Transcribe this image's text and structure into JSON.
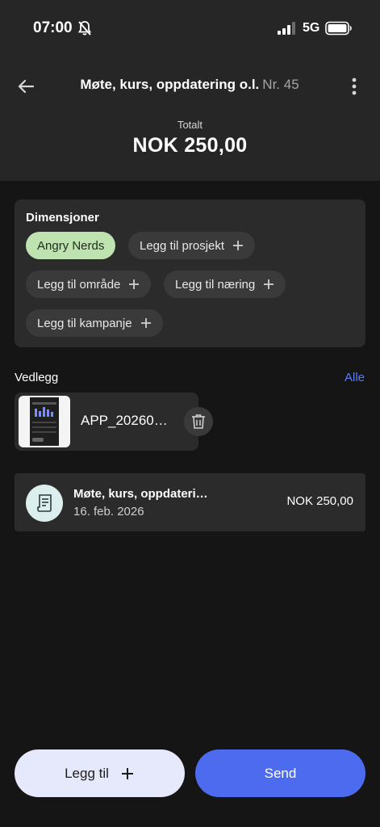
{
  "status_bar": {
    "time": "07:00",
    "network": "5G",
    "icons": [
      "bell-slash-icon",
      "signal-icon",
      "battery-icon"
    ]
  },
  "header": {
    "title": "Møte, kurs, oppdatering o.l.",
    "number": "Nr. 45",
    "total_label": "Totalt",
    "total_value": "NOK 250,00",
    "icons": [
      "arrow-left-icon",
      "more-vertical-icon"
    ]
  },
  "dimensions": {
    "title": "Dimensjoner",
    "chips": [
      {
        "label": "Angry Nerds",
        "active": true
      },
      {
        "label": "Legg til prosjekt",
        "active": false
      },
      {
        "label": "Legg til område",
        "active": false
      },
      {
        "label": "Legg til næring",
        "active": false
      },
      {
        "label": "Legg til kampanje",
        "active": false
      }
    ]
  },
  "attachments": {
    "label": "Vedlegg",
    "all_link": "Alle",
    "items": [
      {
        "name": "APP_20260…"
      }
    ]
  },
  "expense": {
    "title": "Møte, kurs, oppdateri…",
    "date": "16. feb. 2026",
    "amount": "NOK 250,00"
  },
  "actions": {
    "add_label": "Legg til",
    "send_label": "Send"
  },
  "colors": {
    "accent": "#4d6bef",
    "chip_active": "#bfe3b0",
    "card_bg": "#2b2b2b",
    "header_bg": "#262626",
    "page_bg": "#151515"
  }
}
